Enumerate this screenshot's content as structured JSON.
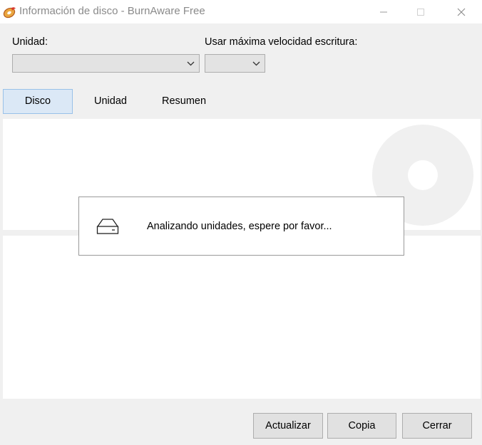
{
  "window": {
    "title": "Información de disco - BurnAware Free",
    "icons": {
      "app": "burnaware-app-icon",
      "minimize": "minimize-icon",
      "maximize": "maximize-icon",
      "close": "close-icon"
    }
  },
  "form": {
    "unit_label": "Unidad:",
    "unit_value": "",
    "speed_label": "Usar máxima velocidad escritura:",
    "speed_value": "",
    "dropdown_icon": "chevron-down-icon"
  },
  "tabs": [
    {
      "label": "Disco",
      "selected": true
    },
    {
      "label": "Unidad",
      "selected": false
    },
    {
      "label": "Resumen",
      "selected": false
    }
  ],
  "progress": {
    "icon": "drive-icon",
    "message": "Analizando unidades, espere por favor..."
  },
  "buttons": {
    "refresh": "Actualizar",
    "copy": "Copia",
    "close": "Cerrar"
  },
  "colors": {
    "selected_tab_bg": "#dbe8f6",
    "selected_tab_border": "#99c1e8",
    "window_bg": "#f0f0f0",
    "watermark": "#f0f0f0"
  }
}
